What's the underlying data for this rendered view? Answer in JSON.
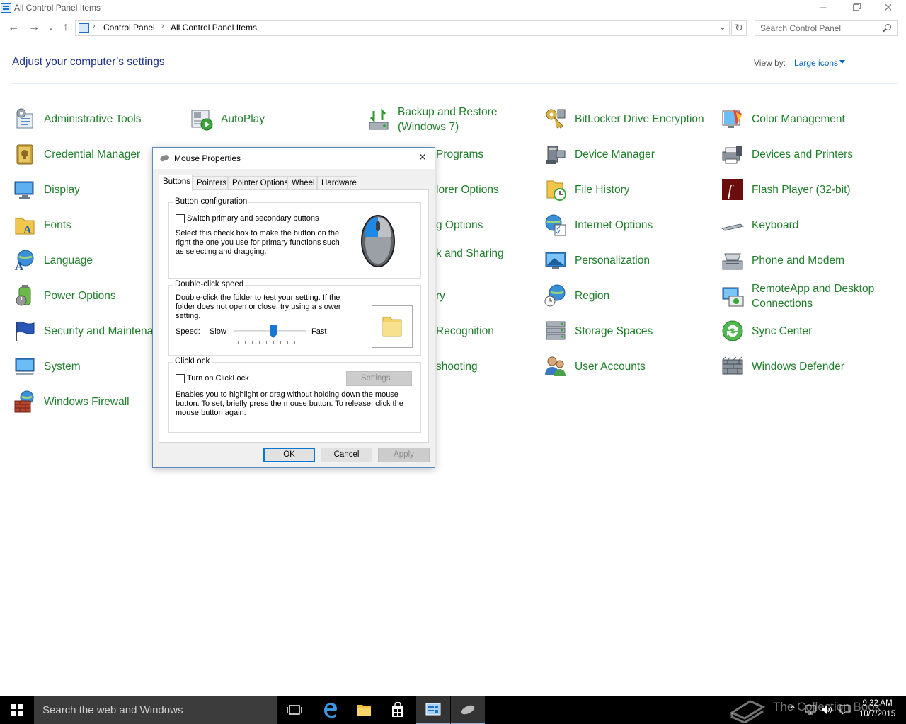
{
  "window": {
    "title": "All Control Panel Items"
  },
  "address": {
    "crumbs": [
      "Control Panel",
      "All Control Panel Items"
    ],
    "search_placeholder": "Search Control Panel"
  },
  "header": {
    "title": "Adjust your computer’s settings",
    "view_by_label": "View by:",
    "view_by_value": "Large icons"
  },
  "items": {
    "c1": [
      "Administrative Tools",
      "Credential Manager",
      "Display",
      "Fonts",
      "Language",
      "Power Options",
      "Security and Maintenance",
      "System",
      "Windows Firewall"
    ],
    "c2": [
      "AutoPlay"
    ],
    "c3": [
      "Backup and Restore",
      "(Windows 7)",
      "Programs",
      "lorer Options",
      "g Options",
      "k and Sharing",
      "ry",
      "Recognition",
      "shooting"
    ],
    "c4": [
      "BitLocker Drive Encryption",
      "Device Manager",
      "File History",
      "Internet Options",
      "Personalization",
      "Region",
      "Storage Spaces",
      "User Accounts"
    ],
    "c5": [
      "Color Management",
      "Devices and Printers",
      "Flash Player (32-bit)",
      "Keyboard",
      "Phone and Modem",
      "RemoteApp and Desktop",
      "Connections",
      "Sync Center",
      "Windows Defender"
    ]
  },
  "dialog": {
    "title": "Mouse Properties",
    "tabs": [
      "Buttons",
      "Pointers",
      "Pointer Options",
      "Wheel",
      "Hardware"
    ],
    "button_config": {
      "title": "Button configuration",
      "checkbox_label": "Switch primary and secondary buttons",
      "desc_lines": [
        "Select this check box to make the button on the",
        "right the one you use for primary functions such",
        "as selecting and dragging."
      ]
    },
    "double_click": {
      "title": "Double-click speed",
      "desc_lines": [
        "Double-click the folder to test your setting. If the",
        "folder does not open or close, try using a slower",
        "setting."
      ],
      "speed_label": "Speed:",
      "slow": "Slow",
      "fast": "Fast",
      "slider_value": 0.55
    },
    "clicklock": {
      "title": "ClickLock",
      "checkbox_label": "Turn on ClickLock",
      "settings_button": "Settings...",
      "desc_lines": [
        "Enables you to highlight or drag without holding down the mouse",
        "button. To set, briefly press the mouse button. To release, click the",
        "mouse button again."
      ]
    },
    "buttons": {
      "ok": "OK",
      "cancel": "Cancel",
      "apply": "Apply"
    }
  },
  "taskbar": {
    "search_text": "Search the web and Windows",
    "time": "9:32 AM",
    "date": "10/7/2015",
    "watermark": "The Collection Book"
  }
}
